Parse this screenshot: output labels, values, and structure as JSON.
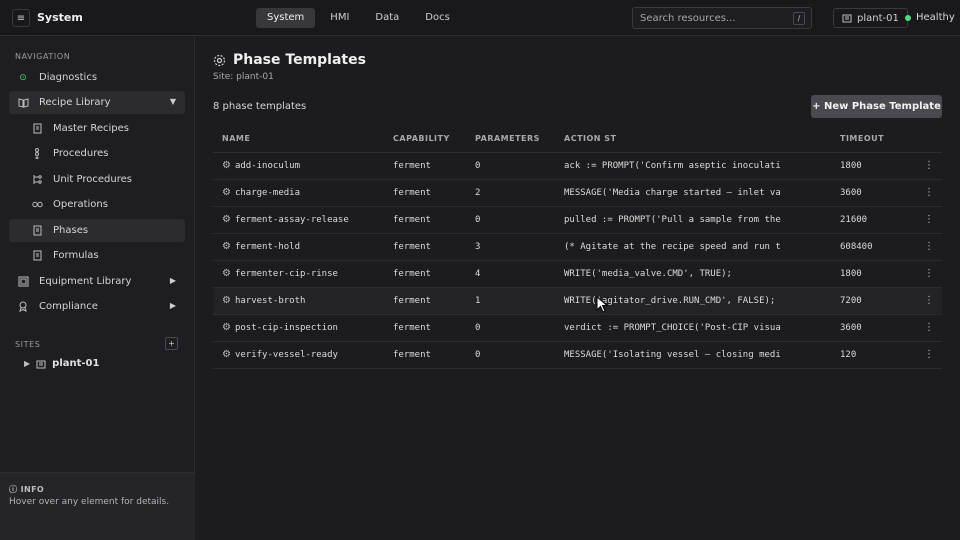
{
  "app": {
    "title": "System"
  },
  "topnav": {
    "tabs": [
      {
        "label": "System",
        "active": true
      },
      {
        "label": "HMI"
      },
      {
        "label": "Data"
      },
      {
        "label": "Docs"
      }
    ]
  },
  "search": {
    "placeholder": "Search resources...",
    "shortcut": "/"
  },
  "site_chip": {
    "label": "plant-01"
  },
  "health": {
    "label": "Healthy",
    "color": "#4ade80"
  },
  "sidebar": {
    "nav_label": "NAVIGATION",
    "items": [
      {
        "label": "Diagnostics",
        "icon": "diagnostics-icon"
      },
      {
        "label": "Recipe Library",
        "icon": "book-icon",
        "expanded": true
      },
      {
        "label": "Master Recipes",
        "icon": "document-icon"
      },
      {
        "label": "Procedures",
        "icon": "procedure-icon"
      },
      {
        "label": "Unit Procedures",
        "icon": "unit-procedure-icon"
      },
      {
        "label": "Operations",
        "icon": "operations-icon"
      },
      {
        "label": "Phases",
        "icon": "phase-icon",
        "active": true
      },
      {
        "label": "Formulas",
        "icon": "formula-icon"
      },
      {
        "label": "Equipment Library",
        "icon": "equipment-icon"
      },
      {
        "label": "Compliance",
        "icon": "compliance-icon"
      }
    ],
    "sites_label": "SITES",
    "sites": [
      {
        "label": "plant-01"
      }
    ],
    "info": {
      "title": "INFO",
      "text": "Hover over any element for details."
    }
  },
  "main": {
    "title": "Phase Templates",
    "subtitle": "Site: plant-01",
    "count": "8 phase templates",
    "new_button": "+ New Phase Template",
    "columns": [
      "NAME",
      "CAPABILITY",
      "PARAMETERS",
      "ACTION ST",
      "TIMEOUT"
    ],
    "rows": [
      {
        "name": "add-inoculum",
        "capability": "ferment",
        "parameters": "0",
        "action": "ack := PROMPT('Confirm aseptic inoculati",
        "timeout": "1800"
      },
      {
        "name": "charge-media",
        "capability": "ferment",
        "parameters": "2",
        "action": "MESSAGE('Media charge started — inlet va",
        "timeout": "3600"
      },
      {
        "name": "ferment-assay-release",
        "capability": "ferment",
        "parameters": "0",
        "action": "pulled := PROMPT('Pull a sample from the",
        "timeout": "21600"
      },
      {
        "name": "ferment-hold",
        "capability": "ferment",
        "parameters": "3",
        "action": "(* Agitate at the recipe speed and run t",
        "timeout": "608400"
      },
      {
        "name": "fermenter-cip-rinse",
        "capability": "ferment",
        "parameters": "4",
        "action": "WRITE('media_valve.CMD', TRUE);",
        "timeout": "1800"
      },
      {
        "name": "harvest-broth",
        "capability": "ferment",
        "parameters": "1",
        "action": "WRITE('agitator_drive.RUN_CMD', FALSE);",
        "timeout": "7200"
      },
      {
        "name": "post-cip-inspection",
        "capability": "ferment",
        "parameters": "0",
        "action": "verdict := PROMPT_CHOICE('Post-CIP visua",
        "timeout": "3600"
      },
      {
        "name": "verify-vessel-ready",
        "capability": "ferment",
        "parameters": "0",
        "action": "MESSAGE('Isolating vessel — closing medi",
        "timeout": "120"
      }
    ]
  }
}
